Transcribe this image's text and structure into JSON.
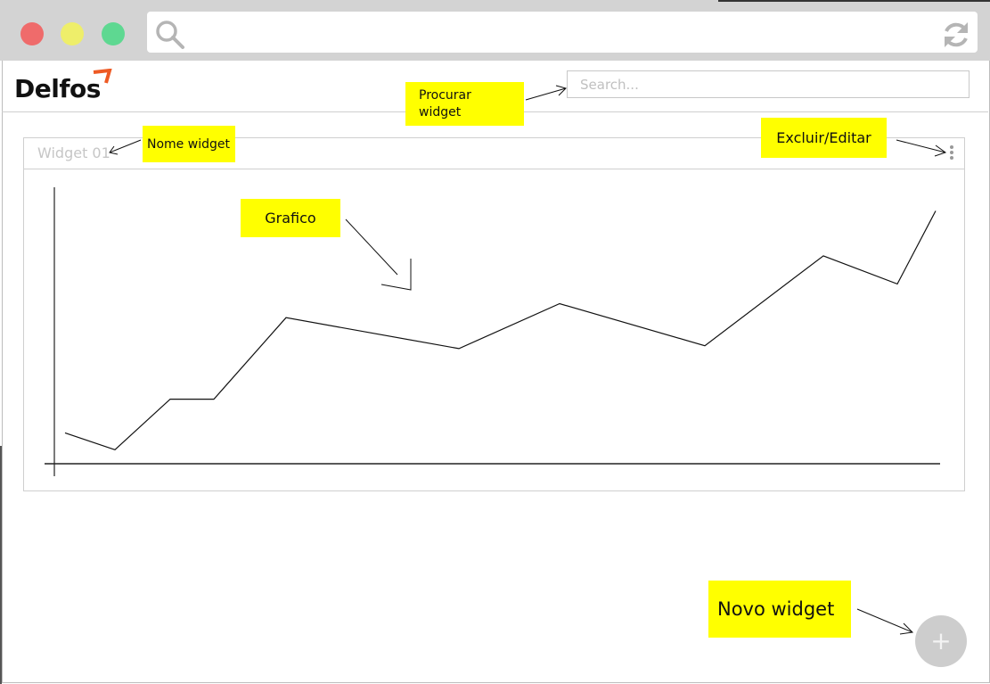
{
  "browser": {
    "search_icon": "search-icon",
    "reload_icon": "reload-icon"
  },
  "header": {
    "logo_text": "Delfos",
    "logo_accent_color": "#ee5a24",
    "search_placeholder": "Search..."
  },
  "widget": {
    "title": "Widget 01",
    "menu_icon": "vertical-dots-icon"
  },
  "chart_data": {
    "type": "line",
    "title": "",
    "xlabel": "",
    "ylabel": "",
    "x": [
      0,
      1,
      2,
      3,
      4,
      5,
      6,
      7,
      8,
      9,
      10,
      11
    ],
    "values": [
      11,
      5,
      23,
      23,
      52,
      41,
      57,
      42,
      74,
      64,
      90,
      null
    ],
    "series": [
      {
        "name": "",
        "values": [
          11,
          5,
          23,
          23,
          52,
          41,
          57,
          42,
          74,
          64,
          90
        ]
      }
    ],
    "ylim": [
      0,
      100
    ],
    "grid": false
  },
  "fab": {
    "symbol": "+"
  },
  "annotations": {
    "procurar": "Procurar widget",
    "nome_widget": "Nome widget",
    "excluir_editar": "Excluir/Editar",
    "grafico": "Grafico",
    "novo_widget": "Novo widget",
    "color": "#ffff00"
  }
}
